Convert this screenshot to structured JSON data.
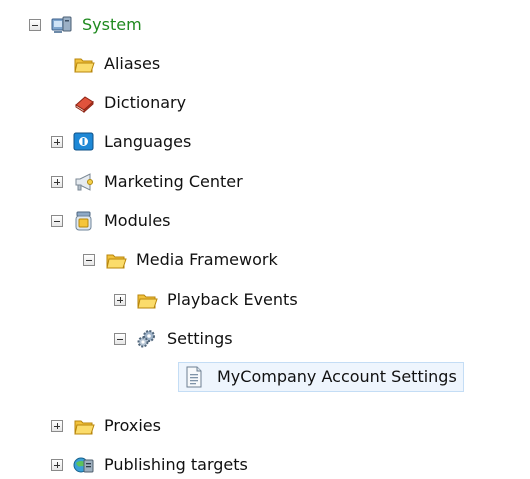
{
  "tree": {
    "root": {
      "label": "System",
      "icon": "system-computer-icon"
    },
    "items": [
      {
        "label": "Aliases",
        "icon": "folder-icon"
      },
      {
        "label": "Dictionary",
        "icon": "dictionary-book-icon"
      },
      {
        "label": "Languages",
        "icon": "languages-icon"
      },
      {
        "label": "Marketing Center",
        "icon": "marketing-megaphone-icon"
      },
      {
        "label": "Modules",
        "icon": "modules-jar-icon"
      },
      {
        "label": "Media Framework",
        "icon": "folder-icon"
      },
      {
        "label": "Playback Events",
        "icon": "folder-icon"
      },
      {
        "label": "Settings",
        "icon": "settings-gears-icon"
      },
      {
        "label": "MyCompany Account Settings",
        "icon": "document-icon"
      },
      {
        "label": "Proxies",
        "icon": "folder-icon"
      },
      {
        "label": "Publishing targets",
        "icon": "publishing-targets-icon"
      }
    ],
    "selected": "MyCompany Account Settings"
  },
  "colors": {
    "root_label": "#1f8a1f",
    "selection_background": "#eef5fd",
    "selection_border": "#c4ddf5",
    "folder": "#f5c842"
  }
}
